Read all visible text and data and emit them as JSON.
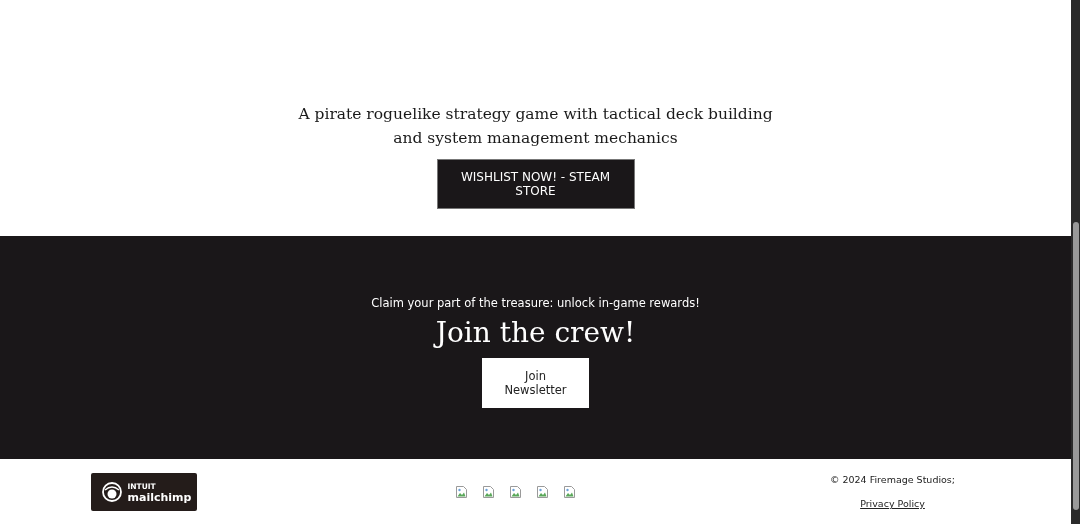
{
  "hero": {
    "tagline": "A pirate roguelike strategy game with tactical deck building and system management mechanics",
    "button": "WISHLIST NOW! - STEAM STORE"
  },
  "newsletter": {
    "subtitle": "Claim your part of the treasure: unlock in-game rewards!",
    "heading": "Join the crew!",
    "button": "Join Newsletter"
  },
  "footer": {
    "badge": {
      "brand_top": "INTUIT",
      "brand_bottom": "mailchimp"
    },
    "social_links": [
      {
        "kind": "broken-image"
      },
      {
        "kind": "broken-image"
      },
      {
        "kind": "broken-image"
      },
      {
        "kind": "broken-image"
      },
      {
        "kind": "broken-image"
      }
    ],
    "copyright": "© 2024 Firemage Studios;",
    "privacy_link": "Privacy Policy"
  }
}
